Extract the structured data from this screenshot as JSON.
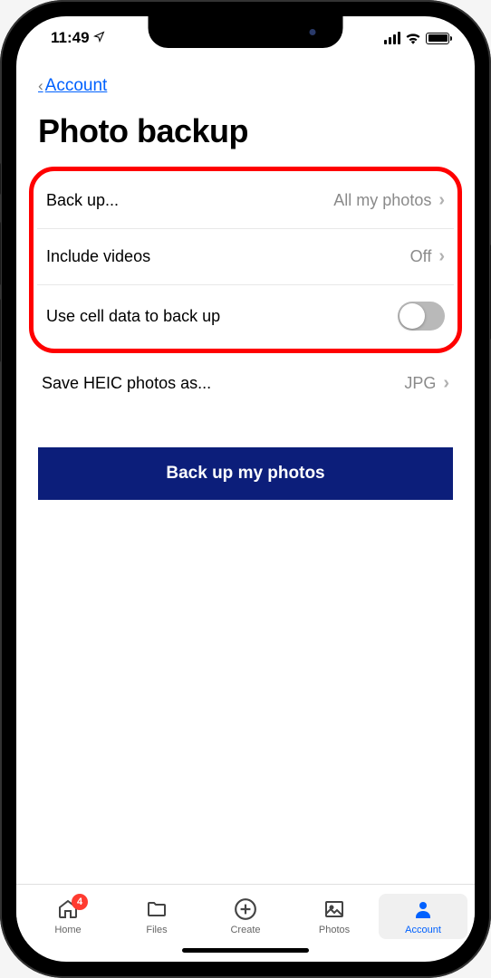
{
  "status": {
    "time": "11:49"
  },
  "nav": {
    "back_label": "Account"
  },
  "page": {
    "title": "Photo backup"
  },
  "settings": {
    "backup": {
      "label": "Back up...",
      "value": "All my photos"
    },
    "include_videos": {
      "label": "Include videos",
      "value": "Off"
    },
    "cell_data": {
      "label": "Use cell data to back up",
      "on": false
    },
    "heic": {
      "label": "Save HEIC photos as...",
      "value": "JPG"
    }
  },
  "cta": {
    "label": "Back up my photos"
  },
  "tabs": {
    "home": {
      "label": "Home",
      "badge": "4"
    },
    "files": {
      "label": "Files"
    },
    "create": {
      "label": "Create"
    },
    "photos": {
      "label": "Photos"
    },
    "account": {
      "label": "Account"
    }
  }
}
